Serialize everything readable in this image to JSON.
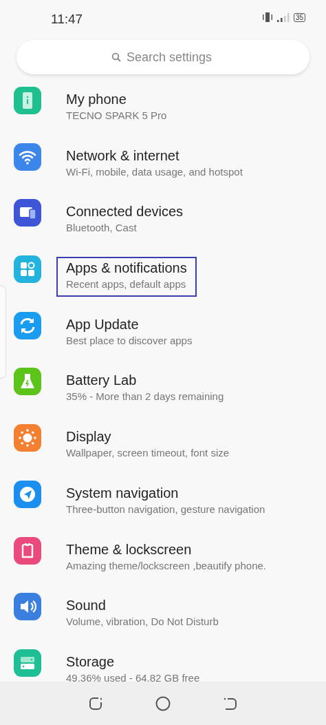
{
  "status_bar": {
    "time": "11:47",
    "battery": "35"
  },
  "search": {
    "placeholder": "Search settings"
  },
  "items": [
    {
      "title": "My phone",
      "subtitle": "TECNO SPARK 5 Pro",
      "kind": "phone",
      "color": "#1fbf8f",
      "highlighted": false
    },
    {
      "title": "Network & internet",
      "subtitle": "Wi-Fi, mobile, data usage, and hotspot",
      "kind": "wifi",
      "color": "#3b86e8",
      "highlighted": false
    },
    {
      "title": "Connected devices",
      "subtitle": "Bluetooth, Cast",
      "kind": "devices",
      "color": "#3d55d6",
      "highlighted": false
    },
    {
      "title": "Apps & notifications",
      "subtitle": "Recent apps, default apps",
      "kind": "apps",
      "color": "#23b3dd",
      "highlighted": true
    },
    {
      "title": "App Update",
      "subtitle": "Best place to discover apps",
      "kind": "update",
      "color": "#1a9cf0",
      "highlighted": false
    },
    {
      "title": "Battery Lab",
      "subtitle": "35% - More than 2 days remaining",
      "kind": "battery",
      "color": "#5cc31b",
      "highlighted": false
    },
    {
      "title": "Display",
      "subtitle": "Wallpaper, screen timeout, font size",
      "kind": "display",
      "color": "#f28030",
      "highlighted": false
    },
    {
      "title": "System navigation",
      "subtitle": "Three-button navigation, gesture navigation",
      "kind": "navigation",
      "color": "#1a8ff0",
      "highlighted": false
    },
    {
      "title": "Theme & lockscreen",
      "subtitle": "Amazing theme/lockscreen ,beautify phone.",
      "kind": "theme",
      "color": "#ea4a7c",
      "highlighted": false
    },
    {
      "title": "Sound",
      "subtitle": "Volume, vibration, Do Not Disturb",
      "kind": "sound",
      "color": "#3a7fe0",
      "highlighted": false
    },
    {
      "title": "Storage",
      "subtitle": "49.36% used - 64.82 GB free",
      "kind": "storage",
      "color": "#1fbf95",
      "highlighted": false
    }
  ]
}
